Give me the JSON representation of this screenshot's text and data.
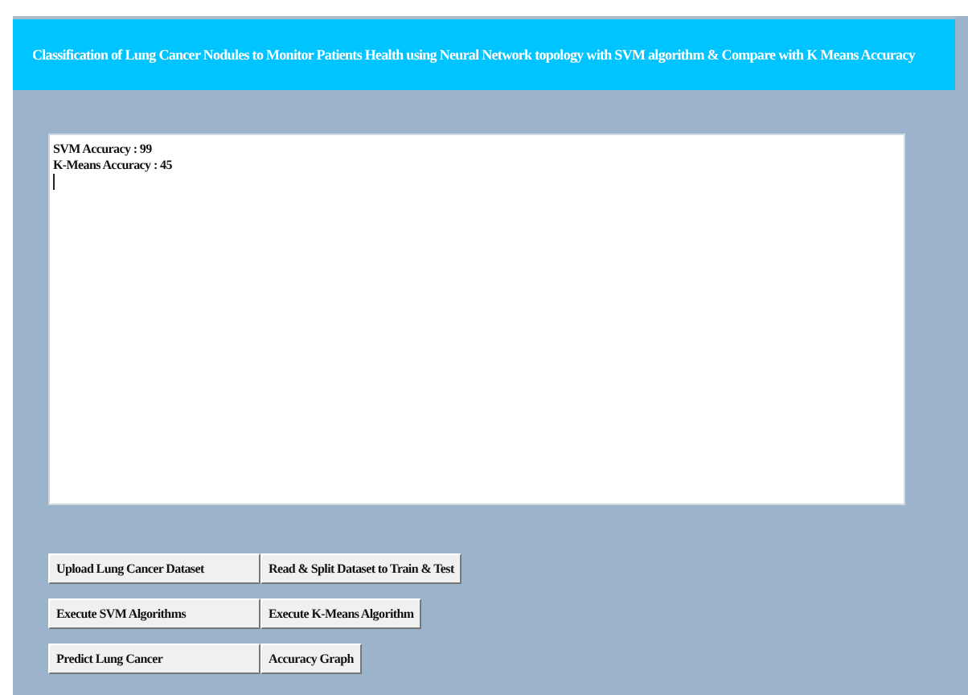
{
  "title": "Classification of Lung Cancer Nodules to Monitor Patients Health using Neural Network topology with SVM algorithm & Compare with K Means Accuracy",
  "output": {
    "lines": [
      "SVM Accuracy : 99",
      "K-Means Accuracy : 45"
    ]
  },
  "buttons": [
    [
      "Upload Lung Cancer Dataset",
      "Read & Split Dataset to Train & Test"
    ],
    [
      "Execute SVM Algorithms",
      "Execute K-Means Algorithm"
    ],
    [
      "Predict Lung Cancer",
      "Accuracy Graph"
    ]
  ]
}
